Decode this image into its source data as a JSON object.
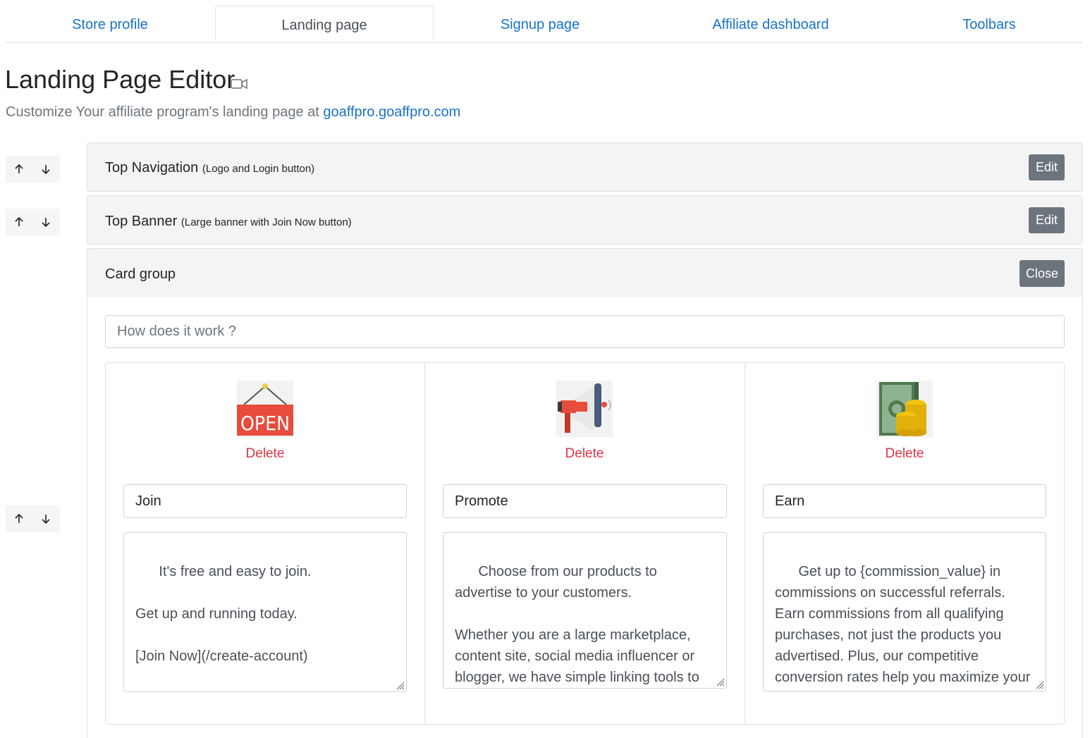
{
  "tabs": [
    {
      "label": "Store profile"
    },
    {
      "label": "Landing page"
    },
    {
      "label": "Signup page"
    },
    {
      "label": "Affiliate dashboard"
    },
    {
      "label": "Toolbars"
    }
  ],
  "header": {
    "title": "Landing Page Editor",
    "subtitle_prefix": "Customize Your affiliate program's landing page at ",
    "subtitle_link": "goaffpro.goaffpro.com"
  },
  "sections": {
    "top_nav": {
      "title": "Top Navigation",
      "note": "(Logo and Login button)",
      "button": "Edit"
    },
    "top_banner": {
      "title": "Top Banner",
      "note": "(Large banner with Join Now button)",
      "button": "Edit"
    },
    "card_group": {
      "title": "Card group",
      "button": "Close",
      "heading_placeholder": "How does it work ?"
    }
  },
  "cards": [
    {
      "icon": "open-sign-icon",
      "delete": "Delete",
      "title": "Join",
      "text": "It's free and easy to join.\n\nGet up and running today.\n\n[Join Now](/create-account)"
    },
    {
      "icon": "megaphone-icon",
      "delete": "Delete",
      "title": "Promote",
      "text": "Choose from our products to advertise to your customers.\n\nWhether you are a large marketplace, content site, social media influencer or blogger, we have simple linking tools to meet your advertising needs and help"
    },
    {
      "icon": "money-coins-icon",
      "delete": "Delete",
      "title": "Earn",
      "text": "Get up to {commission_value} in commissions on successful referrals. Earn commissions from all qualifying purchases, not just the products you advertised. Plus, our competitive conversion rates help you maximize your earnings."
    }
  ],
  "colors": {
    "link": "#1a73c8",
    "delete": "#dc3545",
    "button": "#6c757d"
  }
}
